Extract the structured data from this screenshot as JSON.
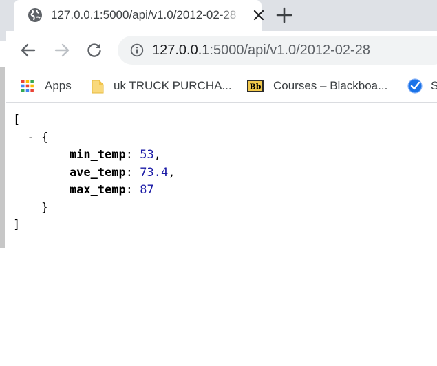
{
  "tab": {
    "title": "127.0.0.1:5000/api/v1.0/2012-02-28",
    "favicon": "globe-icon"
  },
  "toolbar": {
    "back_icon": "back-arrow-icon",
    "forward_icon": "forward-arrow-icon",
    "reload_icon": "reload-icon",
    "info_icon": "info-icon",
    "url_host": "127.0.0.1",
    "url_rest": ":5000/api/v1.0/2012-02-28"
  },
  "bookmarks": [
    {
      "label": "Apps",
      "icon": "apps-grid-icon"
    },
    {
      "label": "uk TRUCK PURCHA...",
      "icon": "folder-icon"
    },
    {
      "label": "Courses – Blackboa...",
      "icon": "blackboard-icon"
    },
    {
      "label": "S",
      "icon": "check-badge-icon"
    }
  ],
  "json_view": {
    "open_bracket": "[",
    "collapse_toggle": "-",
    "open_brace": "{",
    "fields": [
      {
        "key": "min_temp",
        "value": "53",
        "sep": ","
      },
      {
        "key": "ave_temp",
        "value": "73.4",
        "sep": ","
      },
      {
        "key": "max_temp",
        "value": "87",
        "sep": ""
      }
    ],
    "close_brace": "}",
    "close_bracket": "]"
  },
  "colors": {
    "tabstrip": "#dee1e6",
    "omnibox": "#f1f3f4",
    "number": "#1a1aa6"
  }
}
